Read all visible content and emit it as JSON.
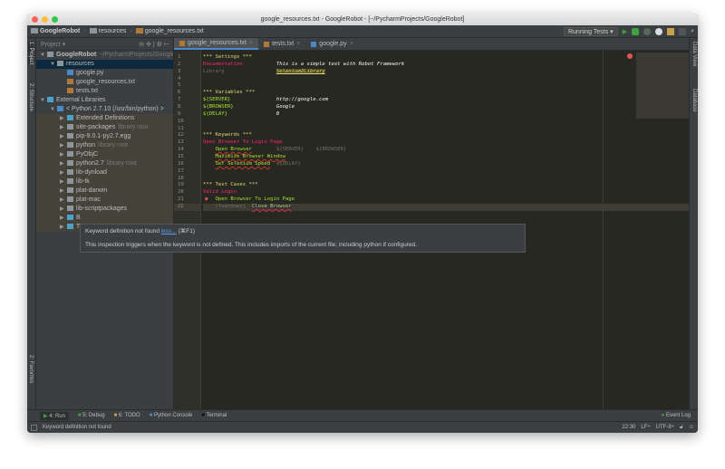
{
  "window": {
    "title": "google_resources.txt - GoogleRobot - [~/PycharmProjects/GoogleRobot]"
  },
  "breadcrumb": [
    "GoogleRobot",
    "resources",
    "google_resources.txt"
  ],
  "toolbar": {
    "run_config": "Running Tests"
  },
  "left_stripe": {
    "project": "1: Project",
    "structure": "2: Structure",
    "favorites": "2: Favorites"
  },
  "right_stripe": {
    "data_view": "Data View",
    "database": "Database"
  },
  "project_panel": {
    "title": "Project",
    "tree": [
      {
        "label": "GoogleRobot",
        "extra": "~/PycharmProjects/GoogleRobot",
        "depth": 0,
        "arrow": "▼",
        "type": "folder"
      },
      {
        "label": "resources",
        "depth": 1,
        "arrow": "▼",
        "type": "folder",
        "selected": true
      },
      {
        "label": "google.py",
        "depth": 2,
        "type": "py"
      },
      {
        "label": "google_resources.txt",
        "depth": 2,
        "type": "robot"
      },
      {
        "label": "tests.txt",
        "depth": 2,
        "type": "robot"
      },
      {
        "label": "External Libraries",
        "depth": 0,
        "arrow": "▼",
        "type": "lib"
      },
      {
        "label": "< Python 2.7.10 (/usr/bin/python) >",
        "depth": 1,
        "arrow": "▼",
        "type": "py"
      },
      {
        "label": "Extended Definitions",
        "depth": 2,
        "arrow": "▶",
        "type": "lib"
      },
      {
        "label": "site-packages",
        "extra": "library root",
        "depth": 2,
        "arrow": "▶",
        "type": "folder"
      },
      {
        "label": "pip-9.0.1-py2.7.egg",
        "depth": 2,
        "arrow": "▶",
        "type": "folder"
      },
      {
        "label": "python",
        "extra": "library root",
        "depth": 2,
        "arrow": "▶",
        "type": "folder"
      },
      {
        "label": "PyObjC",
        "depth": 2,
        "arrow": "▶",
        "type": "folder"
      },
      {
        "label": "python2.7",
        "extra": "library root",
        "depth": 2,
        "arrow": "▶",
        "type": "folder"
      },
      {
        "label": "lib-dynload",
        "depth": 2,
        "arrow": "▶",
        "type": "folder"
      },
      {
        "label": "lib-tk",
        "depth": 2,
        "arrow": "▶",
        "type": "folder"
      },
      {
        "label": "plat-darwin",
        "depth": 2,
        "arrow": "▶",
        "type": "folder"
      },
      {
        "label": "plat-mac",
        "depth": 2,
        "arrow": "▶",
        "type": "folder"
      },
      {
        "label": "lib-scriptpackages",
        "depth": 2,
        "arrow": "▶",
        "type": "folder"
      },
      {
        "label": "B",
        "depth": 2,
        "arrow": "▶",
        "type": "lib"
      },
      {
        "label": "T",
        "depth": 2,
        "arrow": "▶",
        "type": "lib"
      }
    ]
  },
  "tabs": [
    {
      "label": "google_resources.txt",
      "active": true
    },
    {
      "label": "tests.txt"
    },
    {
      "label": "google.py"
    }
  ],
  "editor": {
    "lines": [
      [
        {
          "t": "*** Settings ***",
          "c": "hdr"
        }
      ],
      [
        {
          "t": "Documentation           ",
          "c": "setk"
        },
        {
          "t": "This is a simple test with Robot Framework",
          "c": "doc"
        }
      ],
      [
        {
          "t": "Library                 ",
          "c": "libk"
        },
        {
          "t": "Selenium2Library",
          "c": "ulib"
        }
      ],
      [],
      [],
      [
        {
          "t": "*** Variables ***",
          "c": "hdr"
        }
      ],
      [
        {
          "t": "${SERVER}               ",
          "c": "var"
        },
        {
          "t": "http://google.com",
          "c": "val"
        }
      ],
      [
        {
          "t": "${BROWSER}              ",
          "c": "var"
        },
        {
          "t": "Google",
          "c": "val"
        }
      ],
      [
        {
          "t": "${DELAY}                ",
          "c": "var"
        },
        {
          "t": "0",
          "c": "val"
        }
      ],
      [],
      [],
      [
        {
          "t": "*** Keywords ***",
          "c": "hdr"
        }
      ],
      [
        {
          "t": "Open Browser To Login Page",
          "c": "kw"
        }
      ],
      [
        {
          "t": "    "
        },
        {
          "t": "Open Browser",
          "c": "call"
        },
        {
          "t": "        ${SERVER}    ${BROWSER}",
          "c": "arg"
        }
      ],
      [
        {
          "t": "    "
        },
        {
          "t": "Maximize Browser Window",
          "c": "call"
        }
      ],
      [
        {
          "t": "    "
        },
        {
          "t": "Set Selenium Speed",
          "c": "call"
        },
        {
          "t": "  ${DELAY}",
          "c": "arg"
        }
      ],
      [],
      [],
      [
        {
          "t": "*** Test Cases ***",
          "c": "hdr"
        }
      ],
      [
        {
          "t": "Valid Login",
          "c": "kw"
        }
      ],
      [
        {
          "t": "    "
        },
        {
          "t": "Open Browser To Login Page",
          "c": "tcl"
        }
      ],
      [
        {
          "t": "    [Teardown]  ",
          "c": "td"
        },
        {
          "t": "Close Browser",
          "c": "cb"
        }
      ]
    ]
  },
  "tooltip": {
    "title": "Keyword definition not found",
    "more_link": "less...",
    "shortcut": "(⌘F1)",
    "description": "This inspection triggers when the keyword is not defined. This includes imports of the current file; including python if configured."
  },
  "bottom_tools": [
    {
      "label": "4: Run",
      "color": "#3fa33f"
    },
    {
      "label": "5: Debug",
      "color": "#3fa33f"
    },
    {
      "label": "6: TODO",
      "color": "#c9a24a"
    },
    {
      "label": "Python Console",
      "color": "#4a88c7"
    },
    {
      "label": "Terminal",
      "color": "#111111"
    }
  ],
  "event_log": "Event Log",
  "status": {
    "message": "Keyword definition not found",
    "position": "22:30",
    "line_sep": "LF÷",
    "encoding": "UTF-8÷"
  }
}
